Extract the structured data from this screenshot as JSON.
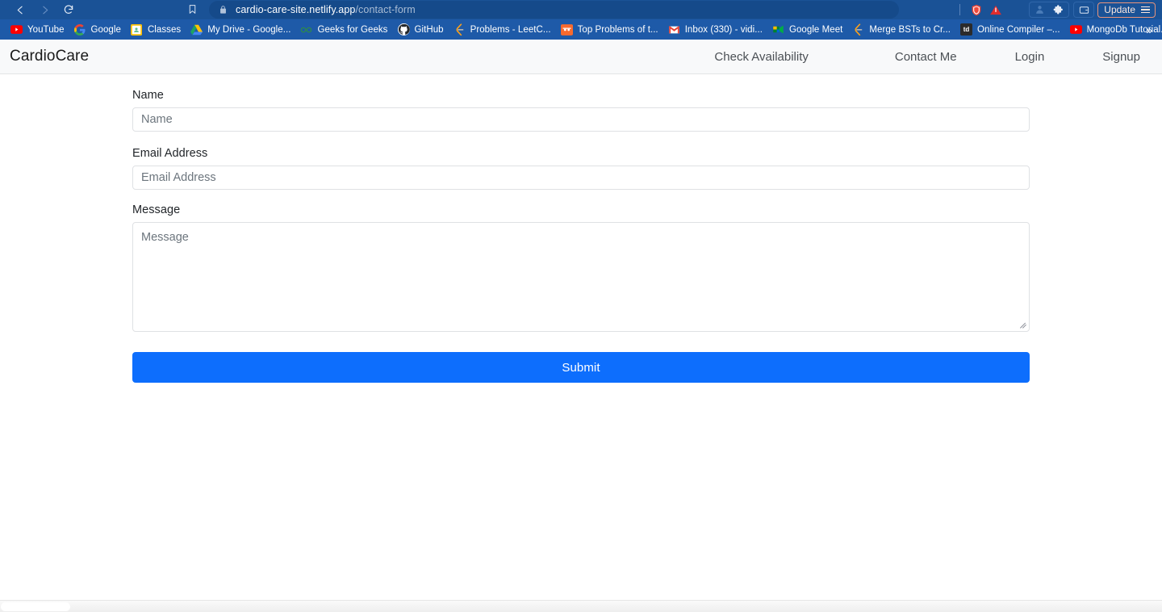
{
  "browser": {
    "back_icon": "back-arrow-icon",
    "forward_icon": "forward-arrow-icon",
    "reload_icon": "reload-icon",
    "bookmark_icon": "bookmark-icon",
    "url_domain": "cardio-care-site.netlify.app",
    "url_path": "/contact-form",
    "lock_icon": "lock-icon",
    "brave_shield_icon": "brave-shield-icon",
    "warning_icon": "warning-triangle-icon",
    "profile_icon": "profile-icon",
    "extensions_icon": "puzzle-extensions-icon",
    "wallet_icon": "brave-wallet-icon",
    "update_label": "Update",
    "menu_icon": "hamburger-menu-icon",
    "overflow_label": "»"
  },
  "bookmarks": [
    {
      "label": "YouTube",
      "icon": "youtube-icon"
    },
    {
      "label": "Google",
      "icon": "google-icon"
    },
    {
      "label": "Classes",
      "icon": "google-classroom-icon"
    },
    {
      "label": "My Drive - Google...",
      "icon": "google-drive-icon"
    },
    {
      "label": "Geeks for Geeks",
      "icon": "geeksforgeeks-icon"
    },
    {
      "label": "GitHub",
      "icon": "github-icon"
    },
    {
      "label": "Problems - LeetC...",
      "icon": "leetcode-icon"
    },
    {
      "label": "Top Problems of t...",
      "icon": "coding-ninjas-icon"
    },
    {
      "label": "Inbox (330) - vidi...",
      "icon": "gmail-icon"
    },
    {
      "label": "Google Meet",
      "icon": "google-meet-icon"
    },
    {
      "label": "Merge BSTs to Cr...",
      "icon": "leetcode-icon"
    },
    {
      "label": "Online Compiler –...",
      "icon": "tutorialspoint-icon"
    },
    {
      "label": "MongoDb Tutorial...",
      "icon": "youtube-icon"
    }
  ],
  "site": {
    "brand": "CardioCare",
    "nav_links": [
      {
        "label": "Check Availability"
      },
      {
        "label": "Contact Me"
      },
      {
        "label": "Login"
      },
      {
        "label": "Signup"
      }
    ]
  },
  "form": {
    "name": {
      "label": "Name",
      "placeholder": "Name",
      "value": ""
    },
    "email": {
      "label": "Email Address",
      "placeholder": "Email Address",
      "value": ""
    },
    "message": {
      "label": "Message",
      "placeholder": "Message",
      "value": ""
    },
    "submit_label": "Submit"
  },
  "colors": {
    "browser_chrome": "#1e5aa8",
    "omnibox": "#154a8a",
    "primary_button": "#0d6efd",
    "navbar_bg": "#f8f9fa",
    "input_border": "#dfe1e4",
    "placeholder": "#6c757d",
    "update_accent": "#e7947c"
  }
}
